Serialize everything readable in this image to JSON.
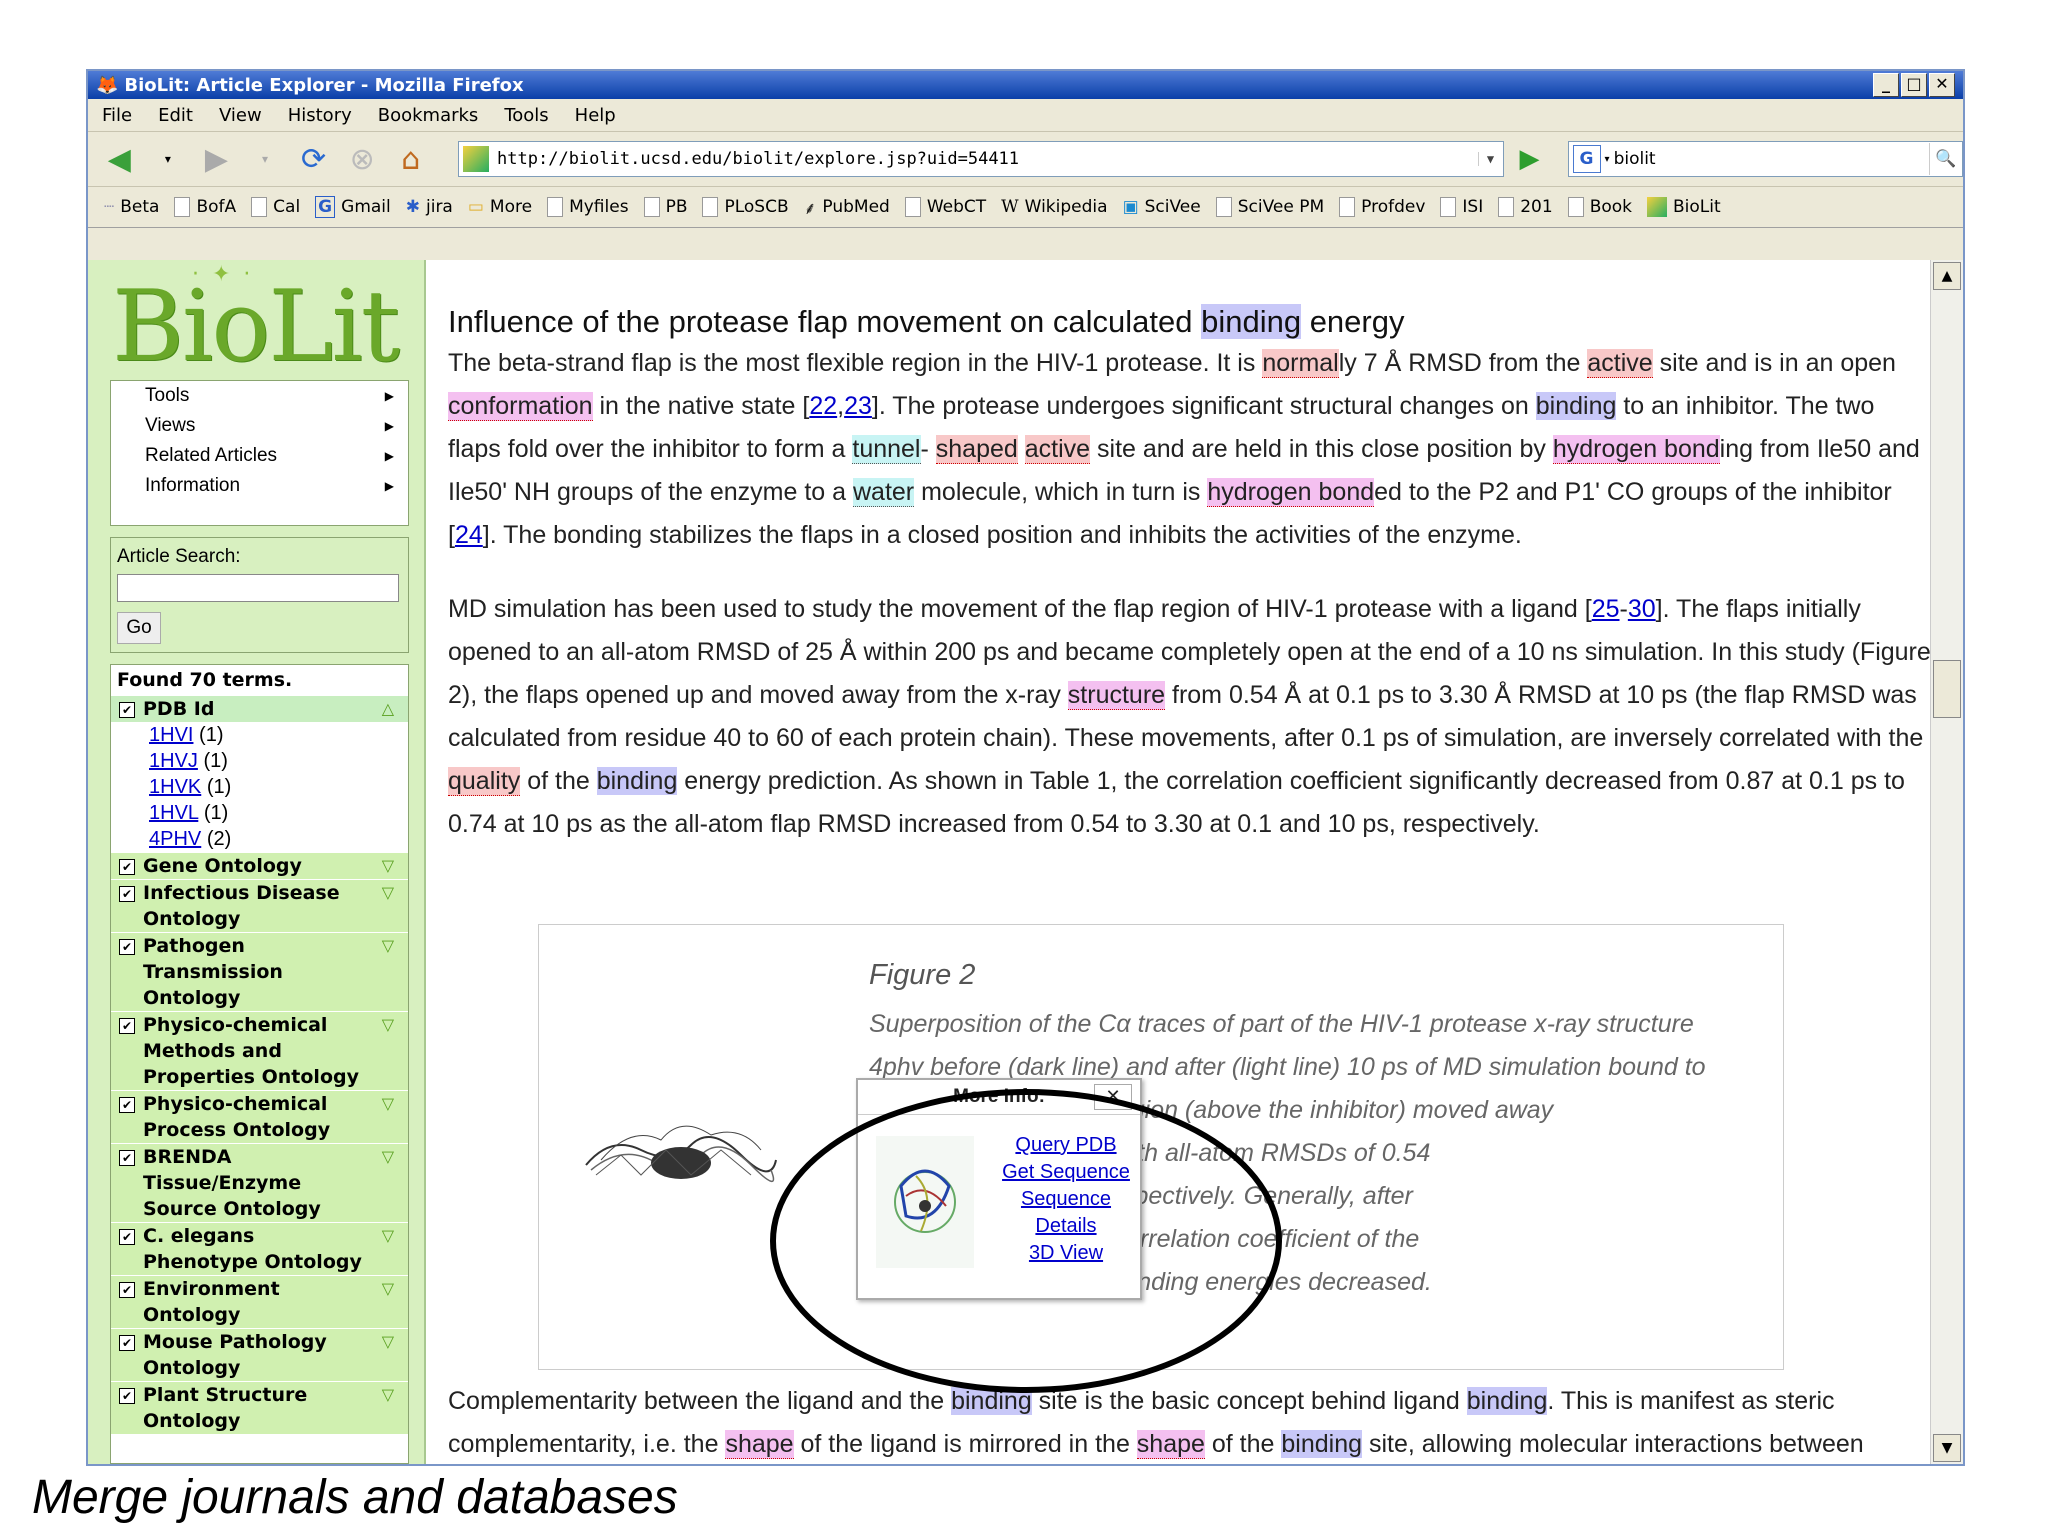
{
  "window": {
    "title": "BioLit: Article Explorer - Mozilla Firefox"
  },
  "menubar": [
    "File",
    "Edit",
    "View",
    "History",
    "Bookmarks",
    "Tools",
    "Help"
  ],
  "url": "http://biolit.ucsd.edu/biolit/explore.jsp?uid=54411",
  "search_value": "biolit",
  "bookmarks": [
    "Beta",
    "BofA",
    "Cal",
    "Gmail",
    "jira",
    "More",
    "Myfiles",
    "PB",
    "PLoSCB",
    "PubMed",
    "WebCT",
    "Wikipedia",
    "SciVee",
    "SciVee PM",
    "Profdev",
    "ISI",
    "201",
    "Book",
    "BioLit"
  ],
  "logo": "BioLit",
  "sidemenu": [
    "Tools",
    "Views",
    "Related Articles",
    "Information"
  ],
  "article_search": {
    "label": "Article Search:",
    "go": "Go"
  },
  "terms": {
    "found": "Found 70 terms.",
    "pdb_label": "PDB Id",
    "pdb_items": [
      {
        "id": "1HVI",
        "count": "(1)"
      },
      {
        "id": "1HVJ",
        "count": "(1)"
      },
      {
        "id": "1HVK",
        "count": "(1)"
      },
      {
        "id": "1HVL",
        "count": "(1)"
      },
      {
        "id": "4PHV",
        "count": "(2)"
      }
    ],
    "ontologies": [
      "Gene Ontology",
      "Infectious Disease Ontology",
      "Pathogen Transmission Ontology",
      "Physico-chemical Methods and Properties Ontology",
      "Physico-chemical Process Ontology",
      "BRENDA Tissue/Enzyme Source Ontology",
      "C. elegans Phenotype Ontology",
      "Environment Ontology",
      "Mouse Pathology Ontology",
      "Plant Structure Ontology"
    ]
  },
  "article": {
    "heading_parts": [
      "Influence of the protease flap movement on calculated ",
      "binding",
      " energy"
    ]
  },
  "figure": {
    "title": "Figure 2",
    "caption_lines": [
      "Superposition of the Cα traces of part of the HIV-1 protease x-ray structure",
      "4phv before (dark line) and after (light line) 10 ps of MD simulation bound to",
      "the inhibitor. The flap region (above the inhibitor) moved away",
      "during the simulation, with all-atom RMSDs of 0.54",
      "and 3.30 Å at 10 ps, respectively. Generally, after",
      "RMSD increased, the correlation coefficient of the",
      "RMSD and calculated binding energies decreased."
    ]
  },
  "popup": {
    "title": "More Info:",
    "close": "✕",
    "links": [
      "Query PDB",
      "Get Sequence",
      "Sequence",
      "Details",
      "3D View"
    ]
  },
  "slide_caption": "Merge journals and databases"
}
